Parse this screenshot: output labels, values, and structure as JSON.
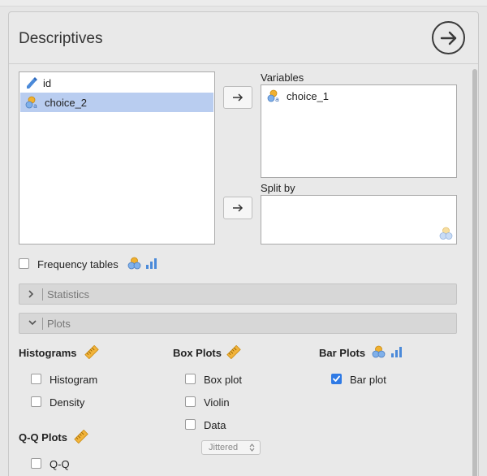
{
  "panel": {
    "title": "Descriptives"
  },
  "source_list": {
    "items": [
      {
        "label": "id",
        "icon": "continuous-variable-icon"
      },
      {
        "label": "choice_2",
        "icon": "nominal-text-variable-icon",
        "selected": true
      }
    ]
  },
  "variables": {
    "label": "Variables",
    "items": [
      {
        "label": "choice_1",
        "icon": "nominal-text-variable-icon"
      }
    ]
  },
  "split_by": {
    "label": "Split by"
  },
  "frequency_tables": {
    "label": "Frequency tables",
    "checked": false
  },
  "sections": {
    "statistics": "Statistics",
    "plots": "Plots"
  },
  "plots": {
    "histograms": {
      "title": "Histograms",
      "options": [
        {
          "label": "Histogram",
          "checked": false
        },
        {
          "label": "Density",
          "checked": false
        }
      ]
    },
    "box_plots": {
      "title": "Box Plots",
      "options": [
        {
          "label": "Box plot",
          "checked": false
        },
        {
          "label": "Violin",
          "checked": false
        },
        {
          "label": "Data",
          "checked": false
        }
      ],
      "data_mode": "Jittered"
    },
    "bar_plots": {
      "title": "Bar Plots",
      "options": [
        {
          "label": "Bar plot",
          "checked": true
        }
      ]
    },
    "qq_plots": {
      "title": "Q-Q Plots",
      "options": [
        {
          "label": "Q-Q",
          "checked": false
        }
      ]
    }
  },
  "colors": {
    "selected_row": "#b9cdf0",
    "checked": "#2f7ae5",
    "ruler": "#f2b43c",
    "nominal_orange": "#f0b030",
    "nominal_blue": "#5b8fd6"
  }
}
